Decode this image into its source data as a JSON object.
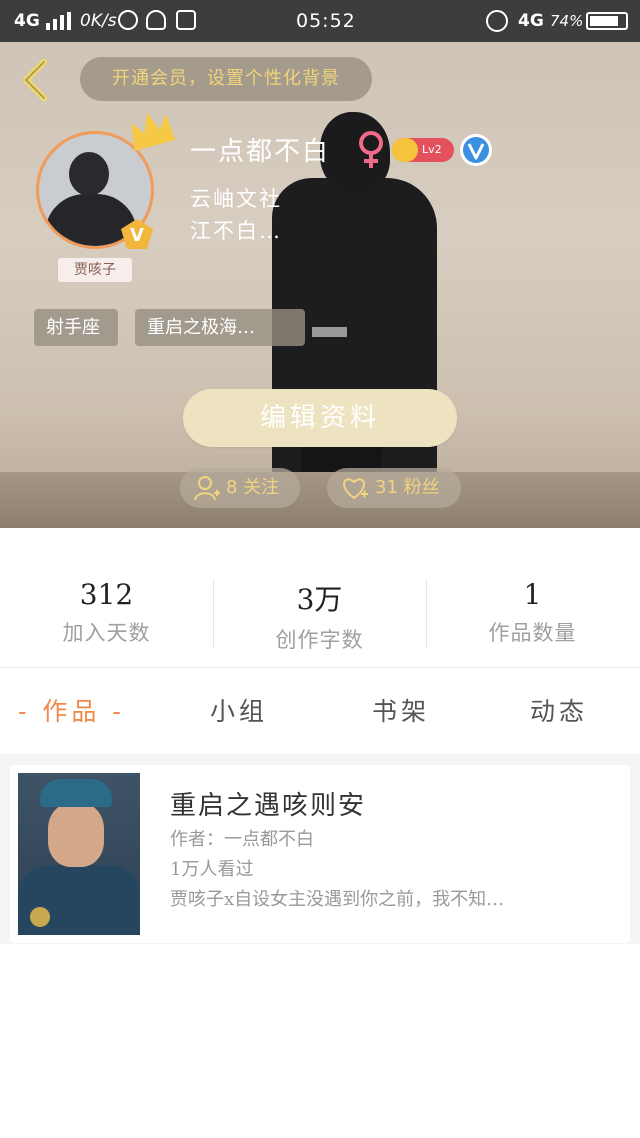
{
  "status_bar": {
    "network": "4G",
    "speed": "0K/s",
    "time": "05:52",
    "network2": "4G",
    "battery": "74%"
  },
  "header": {
    "vip_prompt": "开通会员，设置个性化背景",
    "username": "一点都不白",
    "level": "Lv2",
    "club_line1": "云岫文社",
    "club_line2": "江不白…",
    "avatar_tag": "贾咳子",
    "tags": [
      "射手座",
      "重启之极海…"
    ],
    "edit_button": "编辑资料",
    "following": "8 关注",
    "followers": "31 粉丝"
  },
  "stats": [
    {
      "value": "312",
      "label": "加入天数"
    },
    {
      "value": "3万",
      "label": "创作字数"
    },
    {
      "value": "1",
      "label": "作品数量"
    }
  ],
  "tabs": [
    {
      "label": "- 作品 -",
      "active": true
    },
    {
      "label": "小组",
      "active": false
    },
    {
      "label": "书架",
      "active": false
    },
    {
      "label": "动态",
      "active": false
    }
  ],
  "works": [
    {
      "title": "重启之遇咳则安",
      "author": "作者：一点都不白",
      "views": "1万人看过",
      "desc": "贾咳子x自设女主没遇到你之前，我不知…"
    }
  ],
  "colors": {
    "accent": "#f0894a",
    "vip_text": "#f1d47a",
    "edit_button_bg": "#eee3c1"
  }
}
